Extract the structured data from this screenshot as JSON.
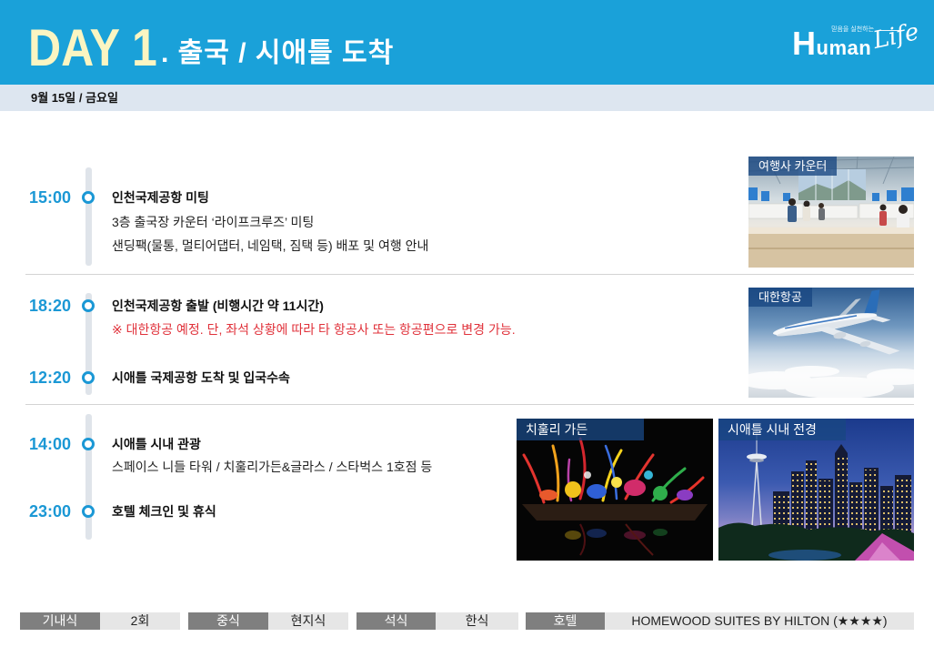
{
  "header": {
    "day": "DAY 1",
    "title": ". 출국 / 시애틀 도착"
  },
  "logo": {
    "tagline": "믿음을 실천하는",
    "name": "Human",
    "script": "Life"
  },
  "date_bar": {
    "date": "9월 15일 / 금요일"
  },
  "timeline": [
    {
      "time": "15:00",
      "title": "인천국제공항 미팅",
      "details": [
        "3층 출국장 카운터 ‘라이프크루즈’ 미팅",
        "샌딩팩(물통, 멀티어댑터, 네임택, 짐택 등) 배포 및 여행 안내"
      ]
    },
    {
      "time": "18:20",
      "title": "인천국제공항 출발 (비행시간 약 11시간)",
      "note": "※ 대한항공 예정. 단, 좌석 상황에 따라 타 항공사 또는 항공편으로 변경 가능."
    },
    {
      "time": "12:20",
      "title": "시애틀 국제공항 도착 및 입국수속"
    },
    {
      "time": "14:00",
      "title": "시애틀 시내 관광",
      "details": [
        "스페이스 니들 타워 / 치훌리가든&글라스 / 스타벅스 1호점 등"
      ]
    },
    {
      "time": "23:00",
      "title": "호텔 체크인 및 휴식"
    }
  ],
  "photos": [
    {
      "label": "여행사 카운터"
    },
    {
      "label": "대한항공"
    },
    {
      "label": "치훌리 가든"
    },
    {
      "label": "시애틀 시내 전경"
    }
  ],
  "summary": [
    {
      "label": "기내식",
      "value": "2회"
    },
    {
      "label": "중식",
      "value": "현지식"
    },
    {
      "label": "석식",
      "value": "한식"
    },
    {
      "label": "호텔",
      "value": "HOMEWOOD SUITES BY HILTON (★★★★)"
    }
  ],
  "colors": {
    "header_background": "#1aa1d9",
    "day_text": "#fbf5c2",
    "time_text": "#1b98d5",
    "note_text": "#e0313a",
    "date_bar_background": "#dde6f0",
    "footer_label_background": "#7f7f7f",
    "footer_value_background": "#e6e6e6"
  }
}
